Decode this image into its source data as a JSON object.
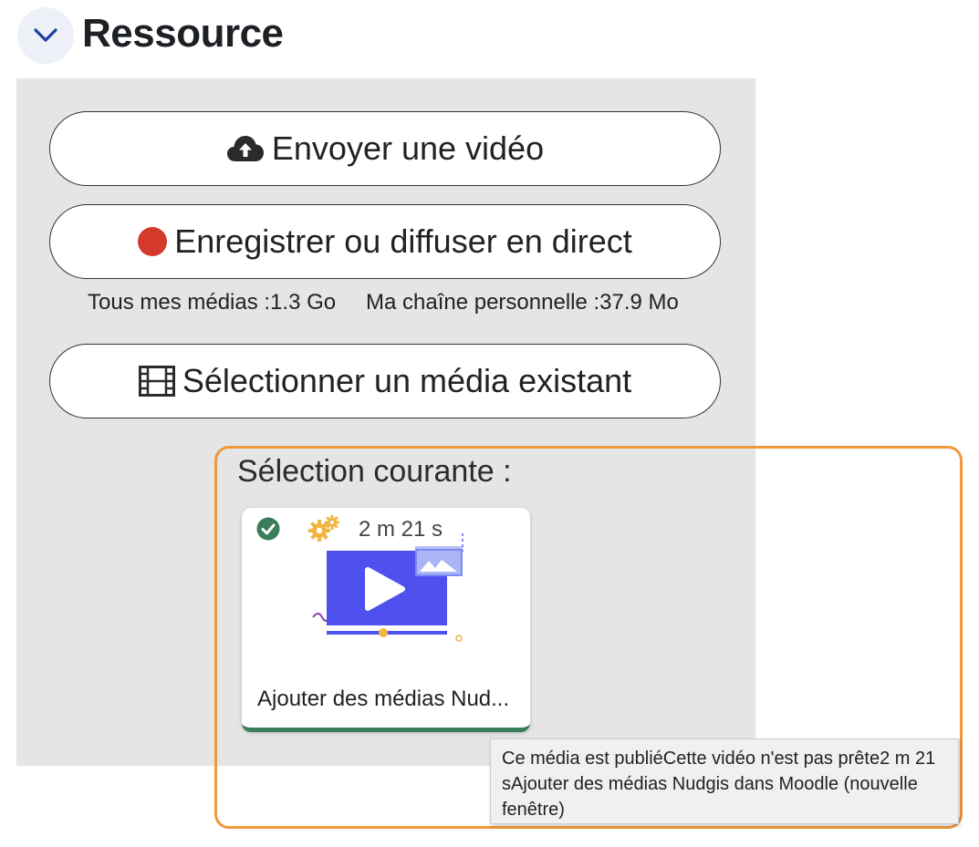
{
  "section": {
    "title": "Ressource",
    "collapse_icon": "chevron-down-icon"
  },
  "buttons": {
    "upload": {
      "label": "Envoyer une vidéo",
      "icon": "cloud-upload-icon"
    },
    "record": {
      "label": "Enregistrer ou diffuser en direct",
      "icon": "record-dot-icon",
      "dot_color": "#d33a2c"
    },
    "select": {
      "label": "Sélectionner un média existant",
      "icon": "film-icon"
    }
  },
  "quota": {
    "all_media": "Tous mes médias :1.3 Go",
    "personal_channel": "Ma chaîne personnelle :37.9 Mo"
  },
  "selection": {
    "label": "Sélection courante :",
    "highlight_color": "#f0993a",
    "card": {
      "duration": "2 m 21 s",
      "title": "Ajouter des médias Nud...",
      "status_icon": "check-circle-icon",
      "processing_icon": "gears-icon",
      "thumbnail_icon": "video-play-icon",
      "status_color": "#3a7d5a"
    }
  },
  "tooltip": {
    "text": "Ce média est publiéCette vidéo n'est pas prête2 m 21 sAjouter des médias Nudgis dans Moodle (nouvelle fenêtre)"
  }
}
